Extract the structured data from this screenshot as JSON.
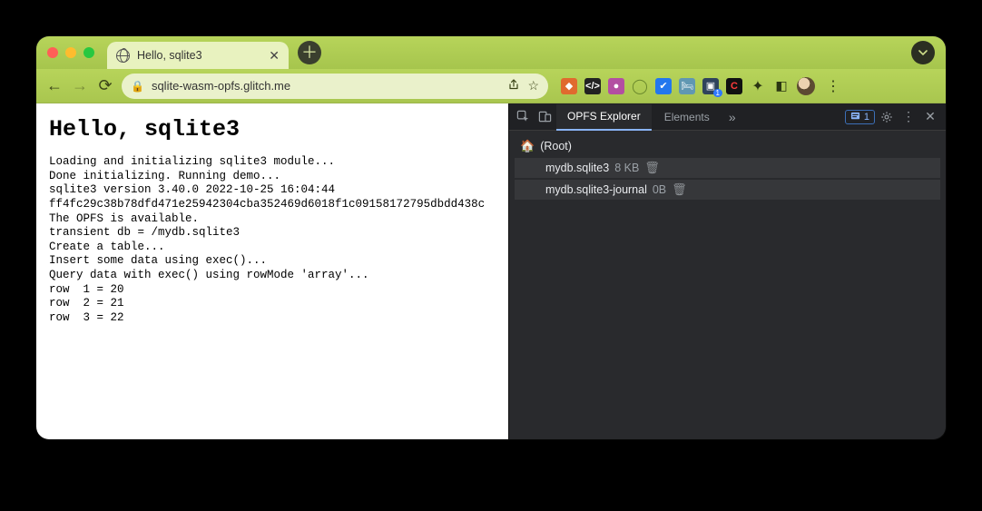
{
  "tabbar": {
    "tab_title": "Hello, sqlite3"
  },
  "toolbar": {
    "url": "sqlite-wasm-opfs.glitch.me"
  },
  "page": {
    "heading": "Hello, sqlite3",
    "lines": [
      "Loading and initializing sqlite3 module...",
      "Done initializing. Running demo...",
      "sqlite3 version 3.40.0 2022-10-25 16:04:44",
      "ff4fc29c38b78dfd471e25942304cba352469d6018f1c09158172795dbdd438c",
      "The OPFS is available.",
      "transient db = /mydb.sqlite3",
      "Create a table...",
      "Insert some data using exec()...",
      "Query data with exec() using rowMode 'array'...",
      "row  1 = 20",
      "row  2 = 21",
      "row  3 = 22"
    ]
  },
  "devtools": {
    "tabs": {
      "active": "OPFS Explorer",
      "next": "Elements",
      "issues_count": "1"
    },
    "tree": {
      "root_label": "(Root)",
      "files": [
        {
          "name": "mydb.sqlite3",
          "size": "8 KB"
        },
        {
          "name": "mydb.sqlite3-journal",
          "size": "0B"
        }
      ]
    }
  }
}
